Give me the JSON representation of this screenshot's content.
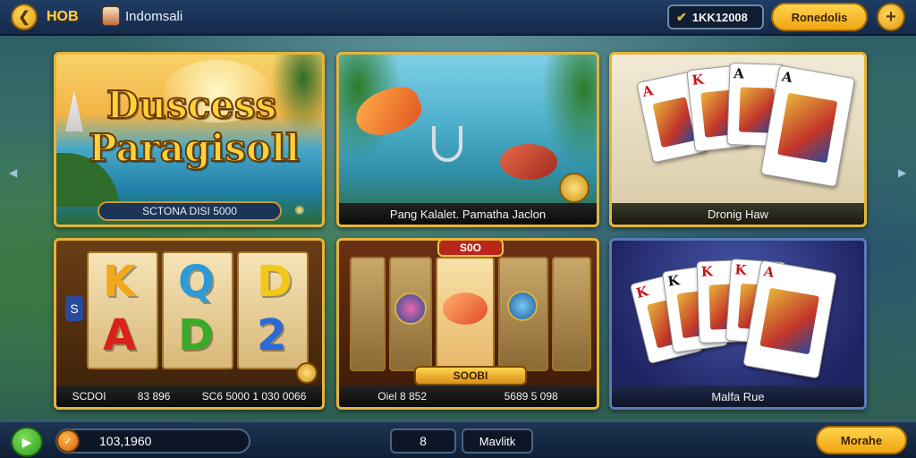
{
  "topbar": {
    "back_icon": "arrow-left-icon",
    "hub_label": "HOB",
    "username": "Indomsali",
    "coins": "1KK12008",
    "rewards_label": "Ronedolis",
    "plus_icon": "plus-icon"
  },
  "games": [
    {
      "title_line1": "Duscess",
      "title_line2": "Paragisoll",
      "caption": "SCTONA DISI 5000"
    },
    {
      "caption": "Pang Kalalet. Pamatha Jaclon"
    },
    {
      "caption": "Dronig Haw"
    },
    {
      "symbols": [
        "K",
        "Q",
        "D",
        "A",
        "D",
        "2"
      ],
      "side_label": "S",
      "caption_left": "SCDOI",
      "caption_mid": "83 896",
      "caption_right": "SC6 5000 1 030 0066"
    },
    {
      "top_badge": "S0O",
      "bet_label": "SOOBI",
      "caption_left": "Oiel 8 852",
      "caption_right": "5689 5 098"
    },
    {
      "caption": "Malfa Rue"
    }
  ],
  "cards_card3": [
    "A",
    "K",
    "A",
    "A"
  ],
  "cards_card6": [
    "K",
    "K",
    "K",
    "K",
    "A"
  ],
  "bottombar": {
    "play_icon": "play-icon",
    "balance": "103,1960",
    "count": "8",
    "mode_label": "Mavlitk",
    "menu_label": "Morahe"
  },
  "colors": {
    "gold": "#e6b43a",
    "topbar": "#1f3d63",
    "accent_button": "#f0a412"
  }
}
